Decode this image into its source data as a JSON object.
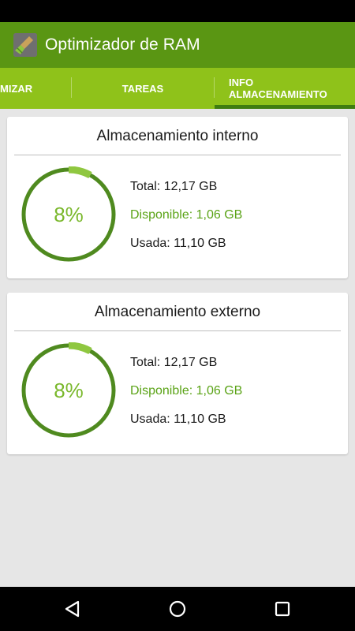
{
  "app": {
    "title": "Optimizador de RAM",
    "icon": "broom-icon",
    "colors": {
      "toolbar": "#5a9613",
      "tabbar": "#8fc21a",
      "tab_indicator": "#3f7d10",
      "ring_dark": "#4f8a1f",
      "ring_light": "#8fc740",
      "available_text": "#5aa316"
    }
  },
  "tabs": [
    {
      "label": "MIZAR",
      "selected": false
    },
    {
      "label": "TAREAS",
      "selected": false
    },
    {
      "label": "INFO ALMACENAMIENTO",
      "line1": "INFO",
      "line2": "ALMACENAMIENTO",
      "selected": true
    }
  ],
  "storage": {
    "internal": {
      "title": "Almacenamiento interno",
      "percent_label": "8%",
      "used_fraction": 0.08,
      "total": "Total: 12,17 GB",
      "available": "Disponible: 1,06 GB",
      "used": "Usada: 11,10 GB"
    },
    "external": {
      "title": "Almacenamiento externo",
      "percent_label": "8%",
      "used_fraction": 0.08,
      "total": "Total: 12,17 GB",
      "available": "Disponible: 1,06 GB",
      "used": "Usada: 11,10 GB"
    }
  },
  "nav": {
    "back": "back-icon",
    "home": "home-icon",
    "recents": "recents-icon"
  }
}
